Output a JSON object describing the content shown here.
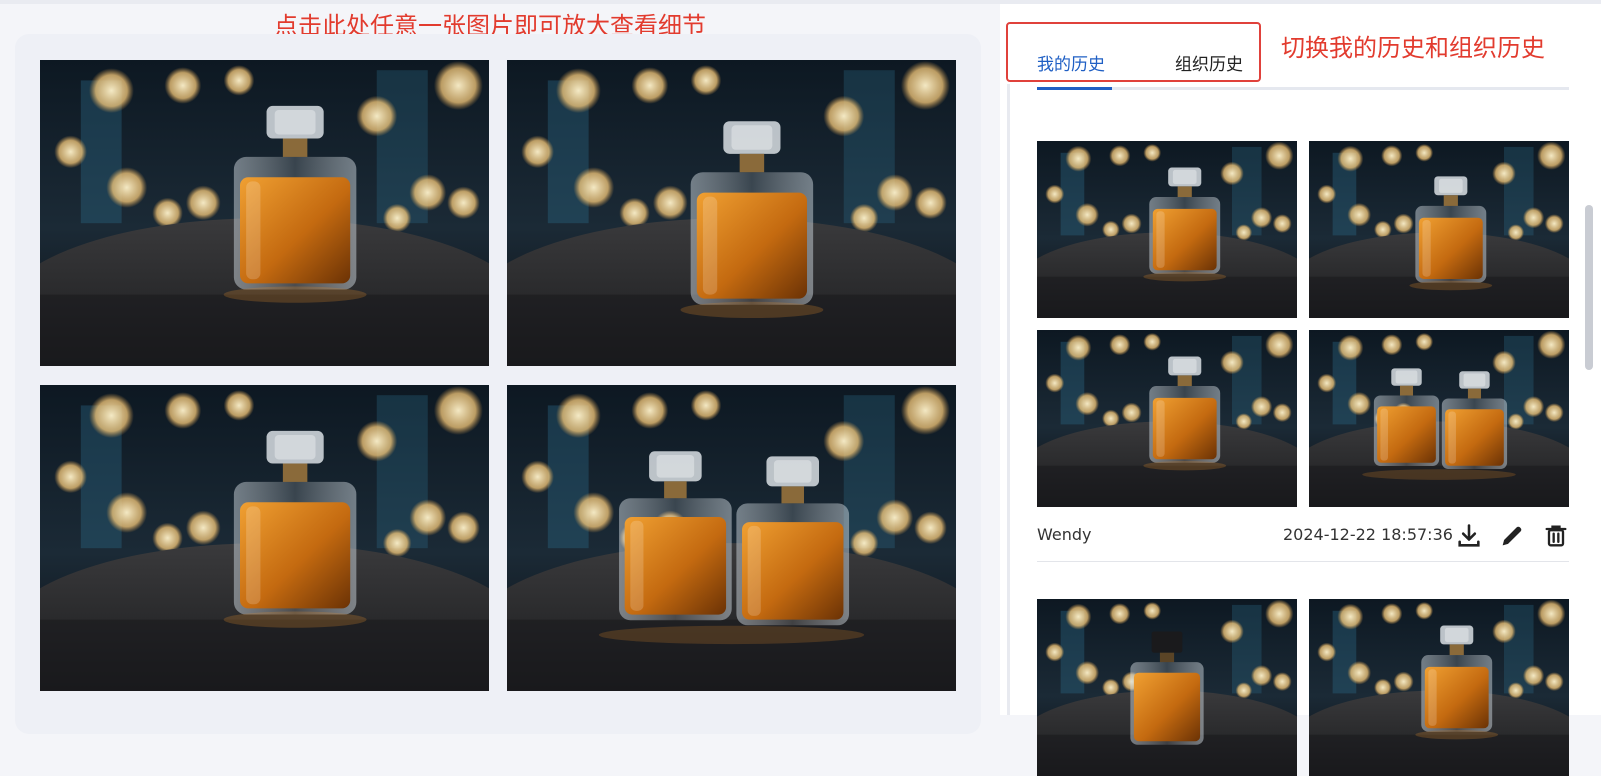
{
  "annotations": {
    "gallery_hint": "点击此处任意一张图片即可放大查看细节",
    "tabs_hint": "切换我的历史和组织历史"
  },
  "tabs": {
    "mine": "我的历史",
    "org": "组织历史",
    "active": "mine"
  },
  "history_item": {
    "user": "Wendy",
    "timestamp": "2024-12-22 18:57:36",
    "actions": [
      "download-icon",
      "edit-pencil-icon",
      "delete-trash-icon"
    ]
  },
  "colors": {
    "accent": "#1f5fc4",
    "annotation": "#e23b2e",
    "perfume_amber": "#c46a10"
  }
}
